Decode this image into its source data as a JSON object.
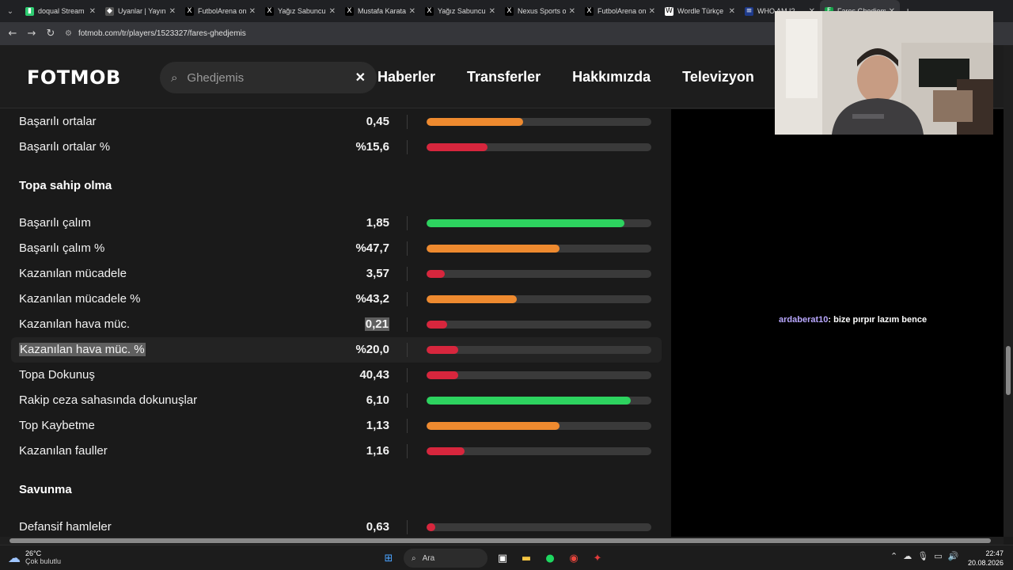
{
  "browser": {
    "tabs": [
      {
        "title": "doqual Stream",
        "icon": "twitch-icon",
        "color": "#2ecc71",
        "glyph": "▮"
      },
      {
        "title": "Uyanlar | Yayın",
        "icon": "kick-icon",
        "color": "#555555",
        "glyph": "◆"
      },
      {
        "title": "FutbolArena on",
        "icon": "x-icon",
        "color": "#000000",
        "glyph": "X"
      },
      {
        "title": "Yağız Sabuncu",
        "icon": "x-icon",
        "color": "#000000",
        "glyph": "X"
      },
      {
        "title": "Mustafa Karata",
        "icon": "x-icon",
        "color": "#000000",
        "glyph": "X"
      },
      {
        "title": "Yağız Sabuncu",
        "icon": "x-icon",
        "color": "#000000",
        "glyph": "X"
      },
      {
        "title": "Nexus Sports o",
        "icon": "x-icon",
        "color": "#000000",
        "glyph": "X"
      },
      {
        "title": "FutbolArena on",
        "icon": "x-icon",
        "color": "#000000",
        "glyph": "X"
      },
      {
        "title": "Wordle Türkçe",
        "icon": "wordle-icon",
        "color": "#ffffff",
        "glyph": "W"
      },
      {
        "title": "WHO AM I?",
        "icon": "site-icon",
        "color": "#1e3a8a",
        "glyph": "≡"
      },
      {
        "title": "Fares Ghedjemis",
        "icon": "fotmob-icon",
        "color": "#16a34a",
        "glyph": "F"
      }
    ],
    "url": "fotmob.com/tr/players/1523327/fares-ghedjemis"
  },
  "header": {
    "logo": "FOTMOB",
    "search_value": "Ghedjemis",
    "nav": [
      "Haberler",
      "Transferler",
      "Hakkımızda",
      "Televizyon"
    ]
  },
  "colors": {
    "green": "#2dd35f",
    "orange": "#ee8a2f",
    "red": "#d7263d",
    "track": "#3a3a3a"
  },
  "stats": {
    "rows": [
      {
        "label": "Başarılı ortalar",
        "value": "0,45",
        "pct": 43,
        "color": "orange"
      },
      {
        "label": "Başarılı ortalar %",
        "value": "%15,6",
        "pct": 27,
        "color": "red"
      },
      {
        "section": "Topa sahip olma"
      },
      {
        "label": "Başarılı çalım",
        "value": "1,85",
        "pct": 88,
        "color": "green"
      },
      {
        "label": "Başarılı çalım %",
        "value": "%47,7",
        "pct": 59,
        "color": "orange"
      },
      {
        "label": "Kazanılan mücadele",
        "value": "3,57",
        "pct": 8,
        "color": "red"
      },
      {
        "label": "Kazanılan mücadele %",
        "value": "%43,2",
        "pct": 40,
        "color": "orange"
      },
      {
        "label": "Kazanılan hava müc.",
        "value": "0,21",
        "pct": 9,
        "color": "red",
        "value_selected": true
      },
      {
        "label": "Kazanılan hava müc. %",
        "value": "%20,0",
        "pct": 14,
        "color": "red",
        "highlight": true
      },
      {
        "label": "Topa Dokunuş",
        "value": "40,43",
        "pct": 14,
        "color": "red"
      },
      {
        "label": "Rakip ceza sahasında dokunuşlar",
        "value": "6,10",
        "pct": 91,
        "color": "green"
      },
      {
        "label": "Top Kaybetme",
        "value": "1,13",
        "pct": 59,
        "color": "orange"
      },
      {
        "label": "Kazanılan fauller",
        "value": "1,16",
        "pct": 17,
        "color": "red"
      },
      {
        "section": "Savunma"
      },
      {
        "label": "Defansif hamleler",
        "value": "0,63",
        "pct": 4,
        "color": "red"
      }
    ]
  },
  "chat": {
    "user": "ardaberat10",
    "message": ": bize pırpır lazım bence"
  },
  "taskbar": {
    "weather_temp": "26°C",
    "weather_desc": "Çok bulutlu",
    "search_placeholder": "Ara",
    "time": "22:47",
    "date": "20.08.2026"
  }
}
